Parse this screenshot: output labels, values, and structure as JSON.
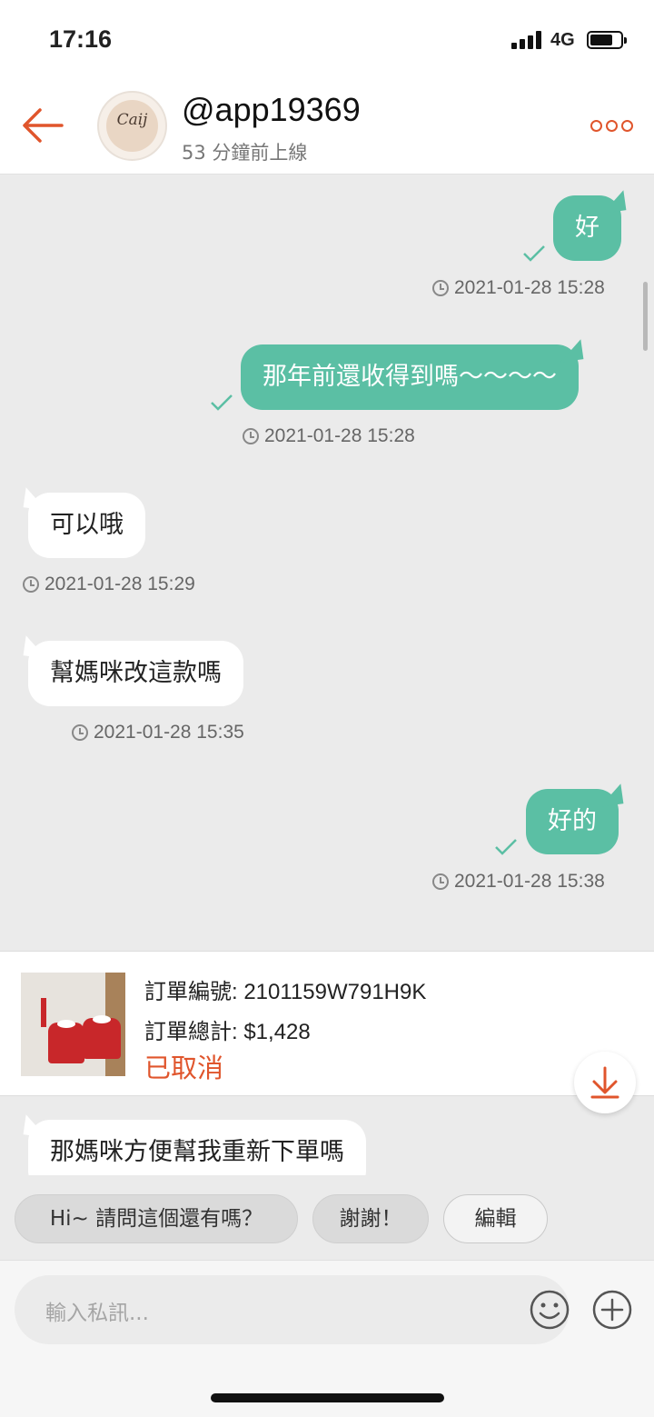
{
  "status_bar": {
    "time": "17:16",
    "network": "4G"
  },
  "header": {
    "username": "@app19369",
    "last_online": "53 分鐘前上線",
    "avatar_logo": "Caij"
  },
  "messages": [
    {
      "direction": "out",
      "text": "好",
      "timestamp": "2021-01-28 15:28",
      "read": true
    },
    {
      "direction": "out",
      "text": "那年前還收得到嗎～～～～",
      "timestamp": "2021-01-28 15:28",
      "read": true
    },
    {
      "direction": "in",
      "text": "可以哦",
      "timestamp": "2021-01-28 15:29"
    },
    {
      "direction": "in",
      "text": "幫媽咪改這款嗎",
      "timestamp": "2021-01-28 15:35"
    },
    {
      "direction": "out",
      "text": "好的",
      "timestamp": "2021-01-28 15:38",
      "read": true
    },
    {
      "direction": "in",
      "text": "那媽咪方便幫我重新下單嗎"
    }
  ],
  "order_card": {
    "order_number": "訂單編號: 2101159W791H9K",
    "order_total": "訂單總計: $1,428",
    "status": "已取消"
  },
  "quick_replies": [
    "Hi~ 請問這個還有嗎？",
    "謝謝！",
    "編輯"
  ],
  "composer": {
    "placeholder": "輸入私訊..."
  },
  "colors": {
    "accent": "#e0552c",
    "outgoing_bubble": "#5bbfa4",
    "incoming_bubble": "#ffffff",
    "chat_background": "#ebebeb"
  },
  "icons": {
    "back": "arrow-left-icon",
    "more": "more-dots-icon",
    "tick": "check-icon",
    "clock": "clock-icon",
    "scroll_bottom": "download-arrow-icon",
    "emoji": "smiley-icon",
    "add": "plus-circle-icon"
  }
}
